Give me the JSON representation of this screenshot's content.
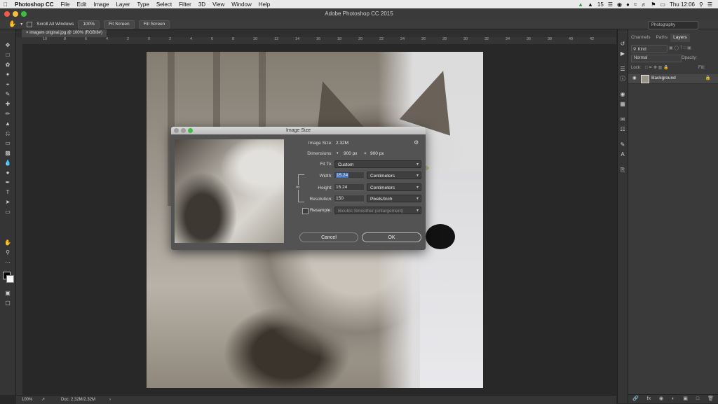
{
  "menubar": {
    "app": "Photoshop CC",
    "items": [
      "File",
      "Edit",
      "Image",
      "Layer",
      "Type",
      "Select",
      "Filter",
      "3D",
      "View",
      "Window",
      "Help"
    ],
    "badge": "15",
    "clock": "Thu 12:06"
  },
  "window": {
    "title": "Adobe Photoshop CC 2015"
  },
  "options": {
    "scroll_all": "Scroll All Windows",
    "btn_100": "100%",
    "btn_fit": "Fit Screen",
    "btn_fill": "Fill Screen",
    "workspace": "Photography"
  },
  "document": {
    "tab": "imagem original.jpg @ 100% (RGB/8#)"
  },
  "ruler": {
    "h": [
      "10",
      "8",
      "6",
      "4",
      "2",
      "0",
      "2",
      "4",
      "6",
      "8",
      "10",
      "12",
      "14",
      "16",
      "18",
      "20",
      "22",
      "24",
      "26",
      "28",
      "30",
      "32",
      "34",
      "36",
      "38",
      "40",
      "42"
    ]
  },
  "status": {
    "zoom": "100%",
    "doc": "Doc: 2.32M/2.32M"
  },
  "panel": {
    "tabs": [
      "Channels",
      "Paths",
      "Layers"
    ],
    "kind": "Kind",
    "blend": "Normal",
    "opacity_label": "Opacity:",
    "lock_label": "Lock:",
    "fill_label": "Fill:",
    "layer_name": "Background"
  },
  "dialog": {
    "title": "Image Size",
    "image_size_label": "Image Size:",
    "image_size_value": "2.32M",
    "dimensions_label": "Dimensions:",
    "dim_w": "900 px",
    "dim_x": "×",
    "dim_h": "900 px",
    "fit_label": "Fit To:",
    "fit_value": "Custom",
    "width_label": "Width:",
    "width_value": "15.24",
    "width_unit": "Centimeters",
    "height_label": "Height:",
    "height_value": "15.24",
    "height_unit": "Centimeters",
    "res_label": "Resolution:",
    "res_value": "150",
    "res_unit": "Pixels/Inch",
    "resample_label": "Resample:",
    "resample_value": "Bicubic Smoother (enlargement)",
    "cancel": "Cancel",
    "ok": "OK"
  },
  "colors": {
    "accent": "#3d6fb6",
    "dialog_bg": "#535353",
    "ui_bg": "#282828"
  }
}
